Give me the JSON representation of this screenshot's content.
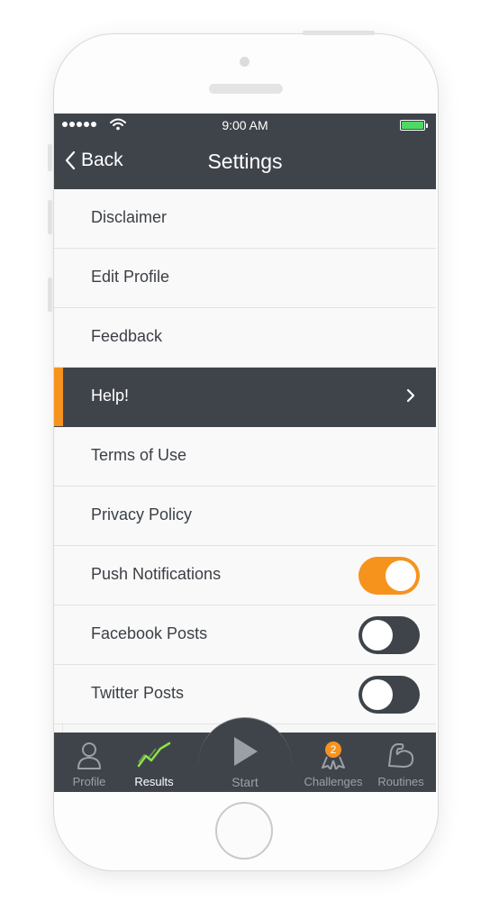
{
  "status_bar": {
    "time": "9:00 AM"
  },
  "nav": {
    "back_label": "Back",
    "title": "Settings"
  },
  "settings": {
    "items": [
      {
        "label": "Disclaimer"
      },
      {
        "label": "Edit Profile"
      },
      {
        "label": "Feedback"
      },
      {
        "label": "Help!"
      },
      {
        "label": "Terms of Use"
      },
      {
        "label": "Privacy Policy"
      },
      {
        "label": "Push Notifications",
        "toggle": true
      },
      {
        "label": "Facebook Posts",
        "toggle": false
      },
      {
        "label": "Twitter Posts",
        "toggle": false
      }
    ],
    "selected": "Help!"
  },
  "tabs": {
    "profile": "Profile",
    "results": "Results",
    "start": "Start",
    "challenges": "Challenges",
    "challenges_badge": "2",
    "routines": "Routines",
    "active": "Results"
  },
  "colors": {
    "bar": "#3f444b",
    "accent": "#f6931d",
    "results_icon": "#8ee04a",
    "battery": "#4cd964"
  },
  "icons": [
    "chevron-left-icon",
    "chevron-right-icon",
    "wifi-icon",
    "battery-icon",
    "person-icon",
    "chart-line-icon",
    "play-icon",
    "ribbon-icon",
    "flexed-arm-icon"
  ]
}
